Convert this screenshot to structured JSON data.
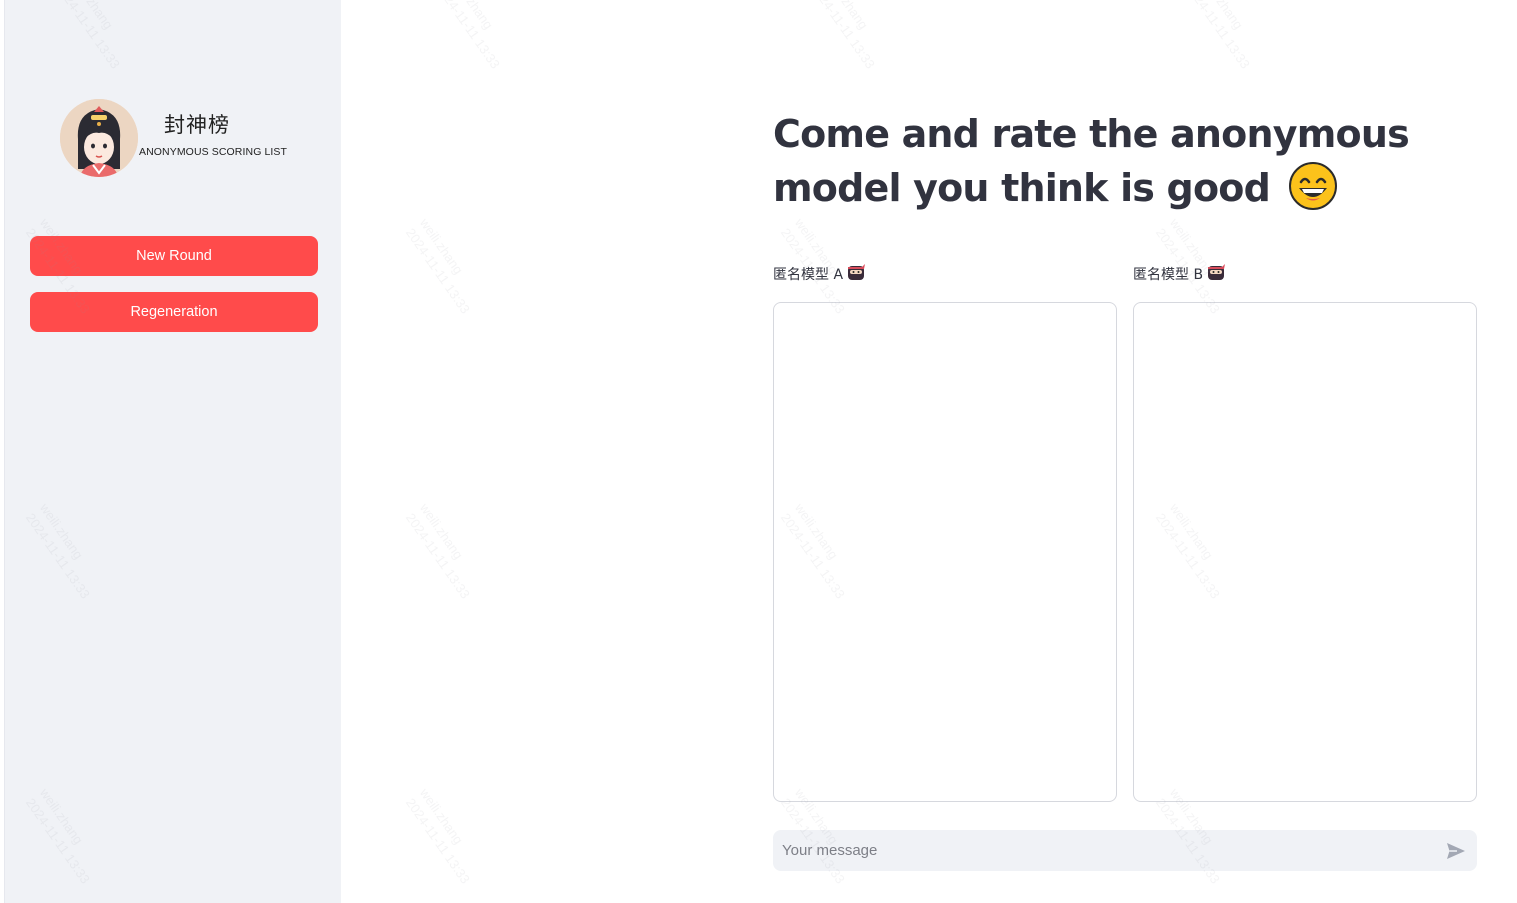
{
  "sidebar": {
    "brand_title": "封神榜",
    "brand_subtitle": "ANONYMOUS SCORING LIST",
    "buttons": {
      "new_round": "New Round",
      "regeneration": "Regeneration"
    }
  },
  "main": {
    "headline": "Come and rate the anonymous model you think is good",
    "model_a_label": "匿名模型 A",
    "model_b_label": "匿名模型 B",
    "chat_input_placeholder": "Your message"
  },
  "watermark": {
    "user": "weili.zhang",
    "datetime": "2024-11-11 13:33"
  },
  "colors": {
    "accent": "#ff4b4b",
    "sidebar_bg": "#f0f2f6",
    "text": "#31333f"
  },
  "icons": [
    "avatar-illustration",
    "grinning-face-emoji",
    "ninja-emoji",
    "send-icon"
  ]
}
